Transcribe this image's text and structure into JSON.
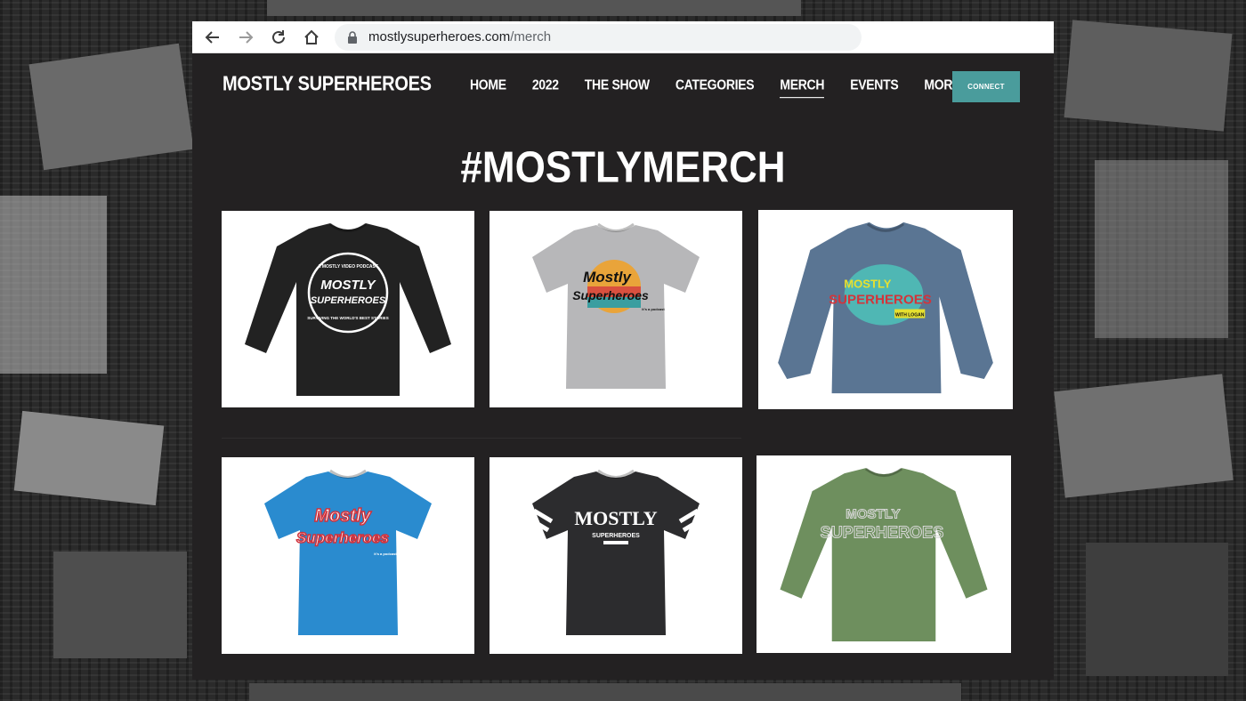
{
  "browser": {
    "url_host": "mostlysuperheroes.com",
    "url_path": "/merch"
  },
  "site": {
    "logo": "MOSTLY SUPERHEROES",
    "nav": [
      {
        "label": "HOME",
        "active": false
      },
      {
        "label": "2022",
        "active": false
      },
      {
        "label": "THE SHOW",
        "active": false
      },
      {
        "label": "CATEGORIES",
        "active": false
      },
      {
        "label": "MERCH",
        "active": true
      },
      {
        "label": "EVENTS",
        "active": false
      },
      {
        "label": "MORE",
        "active": false
      }
    ],
    "connect_label": "CONNECT",
    "connect_color": "#4a9c9c"
  },
  "page": {
    "title": "#MOSTLYMERCH"
  },
  "products": [
    {
      "garment": "long-sleeve",
      "color": "#222222",
      "stripes": false,
      "graphic": {
        "style": "circle-badge",
        "lines": [
          "A MOSTLY VIDEO PODCAST",
          "MOSTLY",
          "SUPERHEROES",
          "SURVIVING THE WORLD'S BEST STORIES"
        ]
      }
    },
    {
      "garment": "tee",
      "color": "#b7b7b9",
      "stripes": false,
      "graphic": {
        "style": "retro-sun",
        "lines": [
          "Mostly",
          "Superheroes",
          "it's a podcast"
        ]
      }
    },
    {
      "garment": "sweatshirt",
      "color": "#5a7593",
      "stripes": false,
      "graphic": {
        "style": "teal-disc",
        "lines": [
          "MOSTLY",
          "SUPERHEROES",
          "WITH LOGAN"
        ]
      }
    },
    {
      "garment": "tee",
      "color": "#2a8bcf",
      "stripes": false,
      "graphic": {
        "style": "script-red",
        "lines": [
          "Mostly",
          "Superheroes",
          "it's a podcast"
        ]
      }
    },
    {
      "garment": "tee",
      "color": "#2c2c2e",
      "stripes": true,
      "graphic": {
        "style": "varsity",
        "lines": [
          "MOSTLY",
          "SUPERHEROES"
        ]
      }
    },
    {
      "garment": "long-sleeve",
      "color": "#6e8f5e",
      "stripes": false,
      "graphic": {
        "style": "outline",
        "lines": [
          "MOSTLY",
          "SUPERHEROES"
        ]
      }
    }
  ]
}
